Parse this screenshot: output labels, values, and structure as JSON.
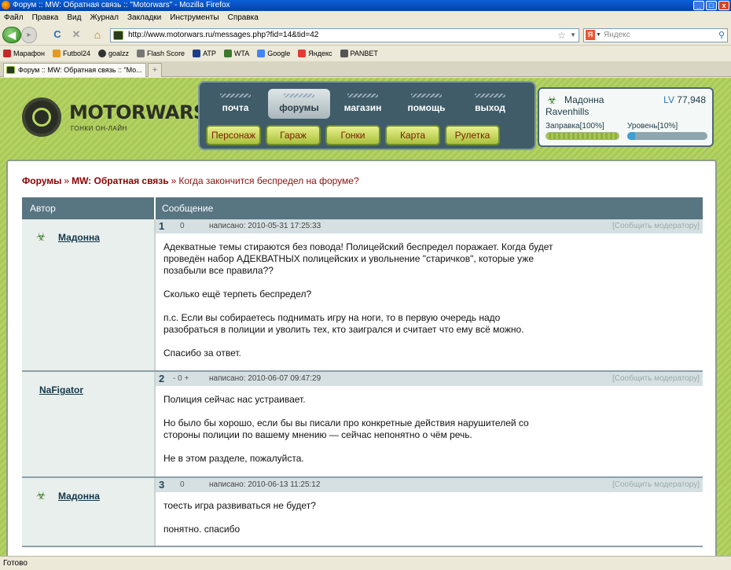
{
  "window": {
    "title": "Форум :: MW: Обратная связь :: \"Motorwars\" - Mozilla Firefox",
    "minimize": "_",
    "maximize": "□",
    "close": "x"
  },
  "menu": [
    "Файл",
    "Правка",
    "Вид",
    "Журнал",
    "Закладки",
    "Инструменты",
    "Справка"
  ],
  "toolbar": {
    "back": "◀",
    "forward": "▸",
    "reload": "C",
    "stop": "✕",
    "home": "⌂",
    "url": "http://www.motorwars.ru/messages.php?fid=14&tid=42",
    "search_engine": "Я",
    "search_placeholder": "Яндекс"
  },
  "bookmarks": [
    {
      "label": "Марафон",
      "color": "#c62828"
    },
    {
      "label": "Futbol24",
      "color": "#e69a1e"
    },
    {
      "label": "goalzz",
      "color": "#333333"
    },
    {
      "label": "Flash Score",
      "color": "#777777"
    },
    {
      "label": "ATP",
      "color": "#1a3e8c"
    },
    {
      "label": "WTA",
      "color": "#3a7a2a"
    },
    {
      "label": "Google",
      "color": "#4285f4"
    },
    {
      "label": "Яндекс",
      "color": "#e53935"
    },
    {
      "label": "PANBET",
      "color": "#555555"
    }
  ],
  "tab": {
    "title": "Форум :: MW: Обратная связь :: \"Mo...",
    "new": "+"
  },
  "site": {
    "logo_name": "MOTORWARS.RU",
    "logo_sub": "ГОНКИ ОН-ЛАЙН",
    "top_nav": [
      {
        "label": "почта",
        "active": false
      },
      {
        "label": "форумы",
        "active": true
      },
      {
        "label": "магазин",
        "active": false
      },
      {
        "label": "помощь",
        "active": false
      },
      {
        "label": "выход",
        "active": false
      }
    ],
    "bottom_nav": [
      "Персонаж",
      "Гараж",
      "Гонки",
      "Карта",
      "Рулетка"
    ],
    "profile": {
      "icon": "☣",
      "name": "Мадонна",
      "clan": "Ravenhills",
      "lv_label": "LV",
      "lv_value": "77,948",
      "fuel_label": "Заправка[100%]",
      "fuel_pct": 1.0,
      "level_label": "Уровень[10%]",
      "level_pct": 0.1
    }
  },
  "forum": {
    "breadcrumb": [
      "Форумы",
      "MW: Обратная связь",
      "Когда закончится беспредел на форуме?"
    ],
    "sep": "»",
    "col_author": "Автор",
    "col_message": "Сообщение",
    "report_label": "[Сообщить модератору]",
    "posts": [
      {
        "num": "1",
        "rating": "0",
        "icon": "☣",
        "author": "Мадонна",
        "date": "написано: 2010-05-31 17:25:33",
        "paragraphs": [
          "Адекватные темы стираются без повода! Полицейский беспредел поражает. Когда будет проведён набор АДЕКВАТНЫХ полицейских и увольнение \"старичков\", которые уже позабыли все правила??",
          "Сколько ещё терпеть беспредел?",
          "п.с. Если вы собираетесь поднимать игру на ноги, то в первую очередь надо разобраться в полиции и уволить тех, кто заигрался и считает что ему всё можно.",
          "Спасибо за ответ."
        ]
      },
      {
        "num": "2",
        "rating": "- 0 +",
        "icon": "",
        "author": "NaFigator",
        "date": "написано: 2010-06-07 09:47:29",
        "paragraphs": [
          "Полиция сейчас нас устраивает.",
          "Но было бы хорошо, если бы вы писали про конкретные действия нарушителей со стороны полиции по вашему мнению — сейчас непонятно о чём речь.",
          "Не в этом разделе, пожалуйста."
        ]
      },
      {
        "num": "3",
        "rating": "0",
        "icon": "☣",
        "author": "Мадонна",
        "date": "написано: 2010-06-13 11:25:12",
        "paragraphs": [
          "тоесть игра развиваться не будет?",
          "понятно. спасибо"
        ]
      }
    ]
  },
  "status": "Готово"
}
